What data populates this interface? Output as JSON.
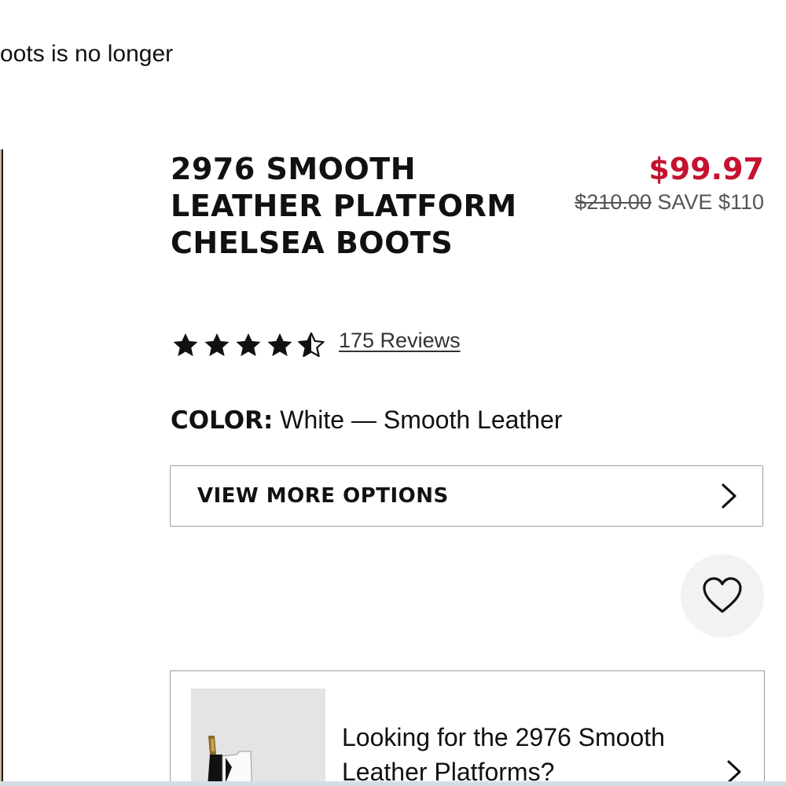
{
  "notice": {
    "text": "oots is no longer"
  },
  "product": {
    "title": "2976 SMOOTH LEATHER PLATFORM CHELSEA BOOTS",
    "sale_price": "$99.97",
    "original_price": "$210.00",
    "savings": "SAVE $110",
    "rating": 4.5,
    "rating_max": 5,
    "reviews_label": "175 Reviews",
    "color_label": "COLOR:",
    "color_value": "White — Smooth Leather"
  },
  "actions": {
    "view_more_label": "VIEW MORE OPTIONS"
  },
  "promo": {
    "text": "Looking for the 2976 Smooth Leather Platforms?"
  },
  "colors": {
    "sale_price": "#c41230",
    "text": "#111111",
    "muted": "#555555",
    "border": "#9a9a9a"
  },
  "icons": {
    "rating": "star-icon",
    "chevron": "chevron-right-icon",
    "wishlist": "heart-icon"
  }
}
